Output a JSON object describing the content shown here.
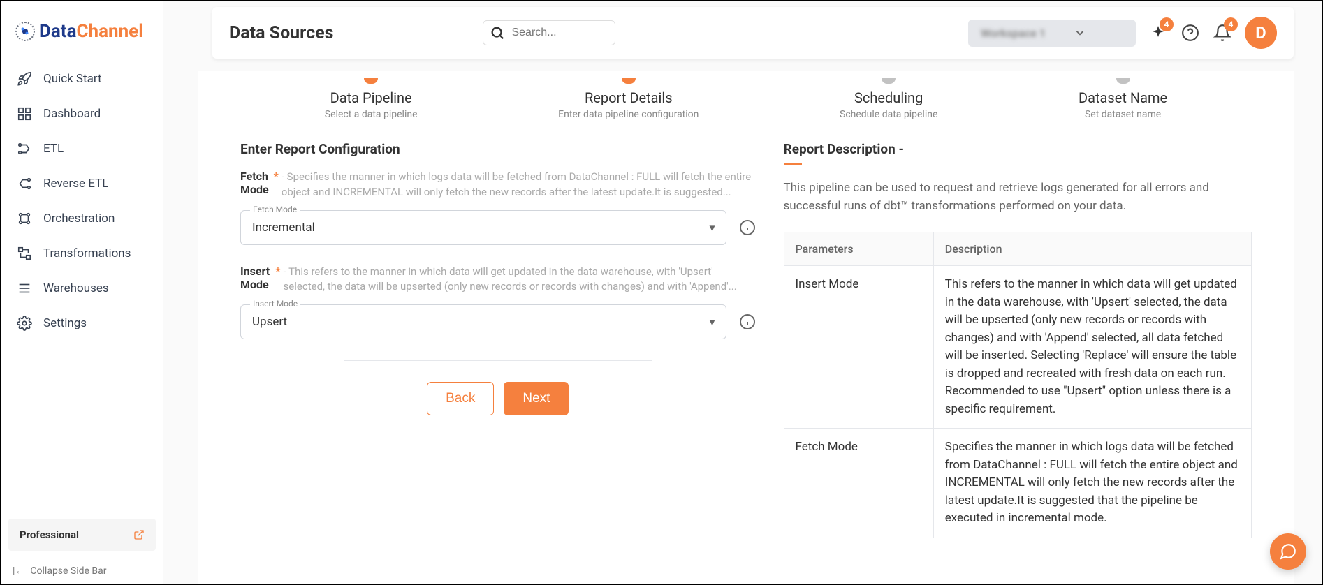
{
  "brand": {
    "part1": "Data",
    "part2": "Channel"
  },
  "page_title": "Data Sources",
  "search": {
    "placeholder": "Search..."
  },
  "workspace_label": "Workspace 1",
  "badges": {
    "notifications": "4",
    "new": "4"
  },
  "avatar_initial": "D",
  "sidebar": {
    "items": [
      {
        "label": "Quick Start"
      },
      {
        "label": "Dashboard"
      },
      {
        "label": "ETL"
      },
      {
        "label": "Reverse ETL"
      },
      {
        "label": "Orchestration"
      },
      {
        "label": "Transformations"
      },
      {
        "label": "Warehouses"
      },
      {
        "label": "Settings"
      }
    ],
    "plan": "Professional",
    "collapse": "Collapse Side Bar"
  },
  "stepper": [
    {
      "title": "Data Pipeline",
      "sub": "Select a data pipeline",
      "active": true
    },
    {
      "title": "Report Details",
      "sub": "Enter data pipeline configuration",
      "active": true
    },
    {
      "title": "Scheduling",
      "sub": "Schedule data pipeline",
      "active": false
    },
    {
      "title": "Dataset Name",
      "sub": "Set dataset name",
      "active": false
    }
  ],
  "config": {
    "section_title": "Enter Report Configuration",
    "fields": [
      {
        "label": "Fetch Mode",
        "required": "*",
        "help": "- Specifies the manner in which logs data will be fetched from DataChannel : FULL will fetch the entire object and INCREMENTAL will only fetch the new records after the latest update.It is suggested...",
        "float_label": "Fetch Mode",
        "value": "Incremental"
      },
      {
        "label": "Insert Mode",
        "required": "*",
        "help": "- This refers to the manner in which data will get updated in the data warehouse, with 'Upsert' selected, the data will be upserted (only new records or records with changes) and with 'Append'...",
        "float_label": "Insert Mode",
        "value": "Upsert"
      }
    ]
  },
  "buttons": {
    "back": "Back",
    "next": "Next"
  },
  "description": {
    "title": "Report Description -",
    "text": "This pipeline can be used to request and retrieve logs generated for all errors and successful runs of dbt™ transformations performed on your data.",
    "table_headers": {
      "param": "Parameters",
      "desc": "Description"
    },
    "params": [
      {
        "name": "Insert Mode",
        "desc": "This refers to the manner in which data will get updated in the data warehouse, with 'Upsert' selected, the data will be upserted (only new records or records with changes) and with 'Append' selected, all data fetched will be inserted. Selecting 'Replace' will ensure the table is dropped and recreated with fresh data on each run. Recommended to use \"Upsert\" option unless there is a specific requirement."
      },
      {
        "name": "Fetch Mode",
        "desc": "Specifies the manner in which logs data will be fetched from DataChannel : FULL will fetch the entire object and INCREMENTAL will only fetch the new records after the latest update.It is suggested that the pipeline be executed in incremental mode."
      }
    ]
  }
}
